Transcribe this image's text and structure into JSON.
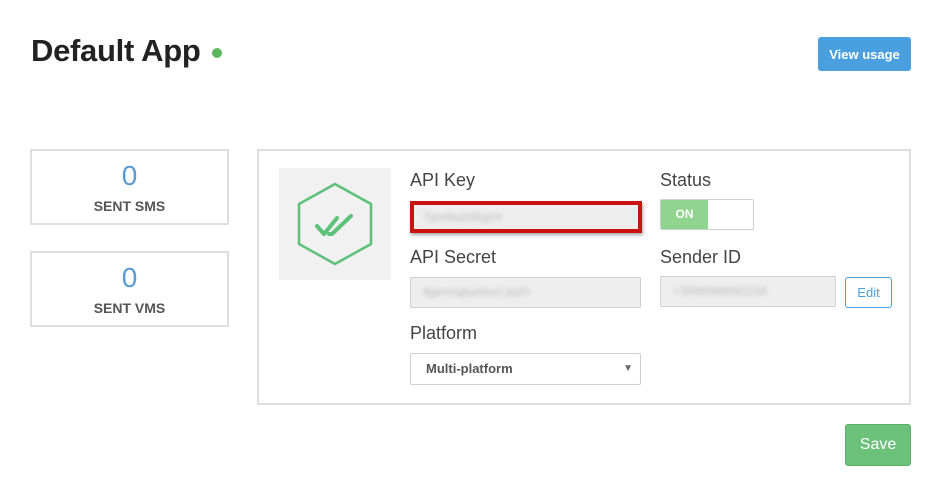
{
  "header": {
    "title": "Default App",
    "view_usage_label": "View usage"
  },
  "stats": [
    {
      "value": "0",
      "label": "SENT SMS"
    },
    {
      "value": "0",
      "label": "SENT VMS"
    }
  ],
  "app": {
    "api_key_label": "API Key",
    "api_key_value": "7pm9a2rt5qzH",
    "api_secret_label": "API Secret",
    "api_secret_value": "8gmmqbw0ncCaxPr",
    "platform_label": "Platform",
    "platform_value": "Multi-platform",
    "status_label": "Status",
    "status_value": "ON",
    "sender_id_label": "Sender ID",
    "sender_id_value": "+3996969692234",
    "edit_label": "Edit"
  },
  "footer": {
    "save_label": "Save"
  },
  "colors": {
    "status_dot": "#5cb85c",
    "primary_button": "#4a9fde",
    "save_button": "#6cc17a",
    "highlight": "#cc1111",
    "logo_green": "#5cc27a"
  },
  "icons": {
    "logo": "hexagon-double-check-icon",
    "select_arrow": "caret-down-icon"
  }
}
